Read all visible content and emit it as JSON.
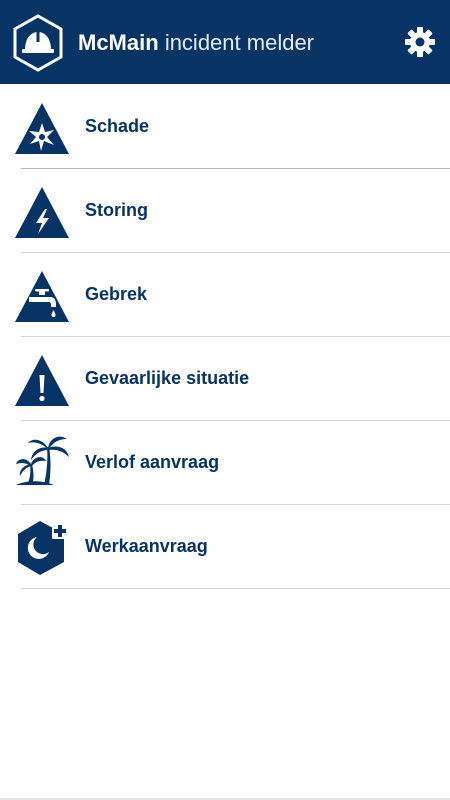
{
  "header": {
    "brand": "McMain",
    "subtitle": "incident melder",
    "background_color": "#073365",
    "logo_icon": "hard-hat-hexagon-icon",
    "settings_icon": "gear-icon"
  },
  "menu": {
    "items": [
      {
        "label": "Schade",
        "icon": "damage-warning-icon"
      },
      {
        "label": "Storing",
        "icon": "lightning-warning-icon"
      },
      {
        "label": "Gebrek",
        "icon": "faucet-warning-icon"
      },
      {
        "label": "Gevaarlijke situatie",
        "icon": "exclamation-warning-icon"
      },
      {
        "label": "Verlof aanvraag",
        "icon": "palm-trees-icon"
      },
      {
        "label": "Werkaanvraag",
        "icon": "hexagon-moon-plus-icon"
      }
    ],
    "accent_color": "#073365"
  }
}
